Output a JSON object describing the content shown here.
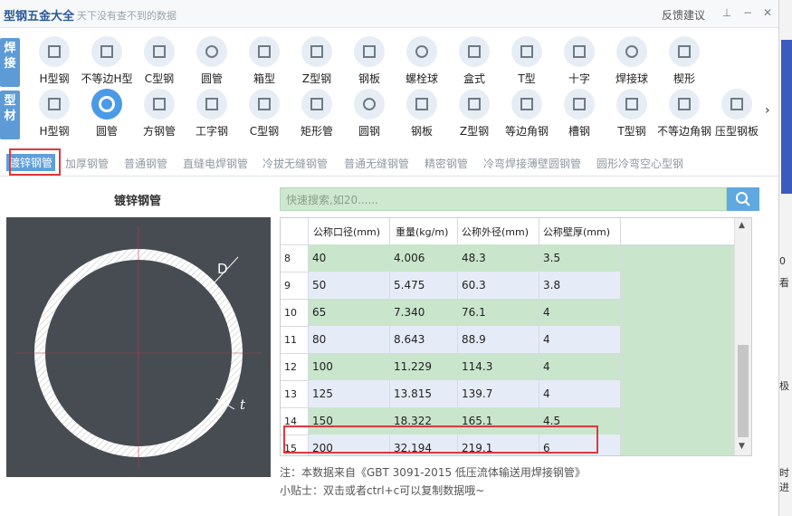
{
  "app": {
    "title": "型钢五金大全",
    "slogan": "天下没有查不到的数据",
    "feedback": "反馈建议"
  },
  "categories": {
    "weld_label": "焊接",
    "profile_label": "型材"
  },
  "row1_items": [
    "H型钢",
    "不等边H型",
    "C型钢",
    "圆管",
    "箱型",
    "Z型钢",
    "钢板",
    "螺栓球",
    "盒式",
    "T型",
    "十字",
    "焊接球",
    "楔形"
  ],
  "row2_items": [
    "H型钢",
    "圆管",
    "方钢管",
    "工字钢",
    "C型钢",
    "矩形管",
    "圆钢",
    "钢板",
    "Z型钢",
    "等边角钢",
    "槽钢",
    "T型钢",
    "不等边角钢",
    "压型钢板"
  ],
  "tabs": [
    "镀锌钢管",
    "加厚钢管",
    "普通钢管",
    "直缝电焊钢管",
    "冷拔无缝钢管",
    "普通无缝钢管",
    "精密钢管",
    "冷弯焊接薄壁圆钢管",
    "圆形冷弯空心型钢"
  ],
  "diagram": {
    "title": "镀锌钢管",
    "label_d": "D",
    "label_t": "t"
  },
  "search": {
    "placeholder": "快速搜索,如20......"
  },
  "table": {
    "headers": [
      "公称口径(mm)",
      "重量(kg/m)",
      "公称外径(mm)",
      "公称壁厚(mm)"
    ],
    "rows": [
      {
        "n": "8",
        "c": [
          "40",
          "4.006",
          "48.3",
          "3.5"
        ]
      },
      {
        "n": "9",
        "c": [
          "50",
          "5.475",
          "60.3",
          "3.8"
        ]
      },
      {
        "n": "10",
        "c": [
          "65",
          "7.340",
          "76.1",
          "4"
        ]
      },
      {
        "n": "11",
        "c": [
          "80",
          "8.643",
          "88.9",
          "4"
        ]
      },
      {
        "n": "12",
        "c": [
          "100",
          "11.229",
          "114.3",
          "4"
        ]
      },
      {
        "n": "13",
        "c": [
          "125",
          "13.815",
          "139.7",
          "4"
        ]
      },
      {
        "n": "14",
        "c": [
          "150",
          "18.322",
          "165.1",
          "4.5"
        ]
      },
      {
        "n": "15",
        "c": [
          "200",
          "32.194",
          "219.1",
          "6"
        ]
      }
    ]
  },
  "notes": {
    "source": "注：本数据来自《GBT 3091-2015 低压流体输送用焊接钢管》",
    "tip": "小贴士：双击或者ctrl+c可以复制数据哦~"
  },
  "side_window": {
    "texts": [
      "0",
      "看",
      "极",
      "时进"
    ]
  },
  "colors": {
    "accent": "#5fa0da",
    "row_green": "#c9e5cc",
    "row_blue": "#e6ecf7",
    "highlight": "#e0383d"
  }
}
